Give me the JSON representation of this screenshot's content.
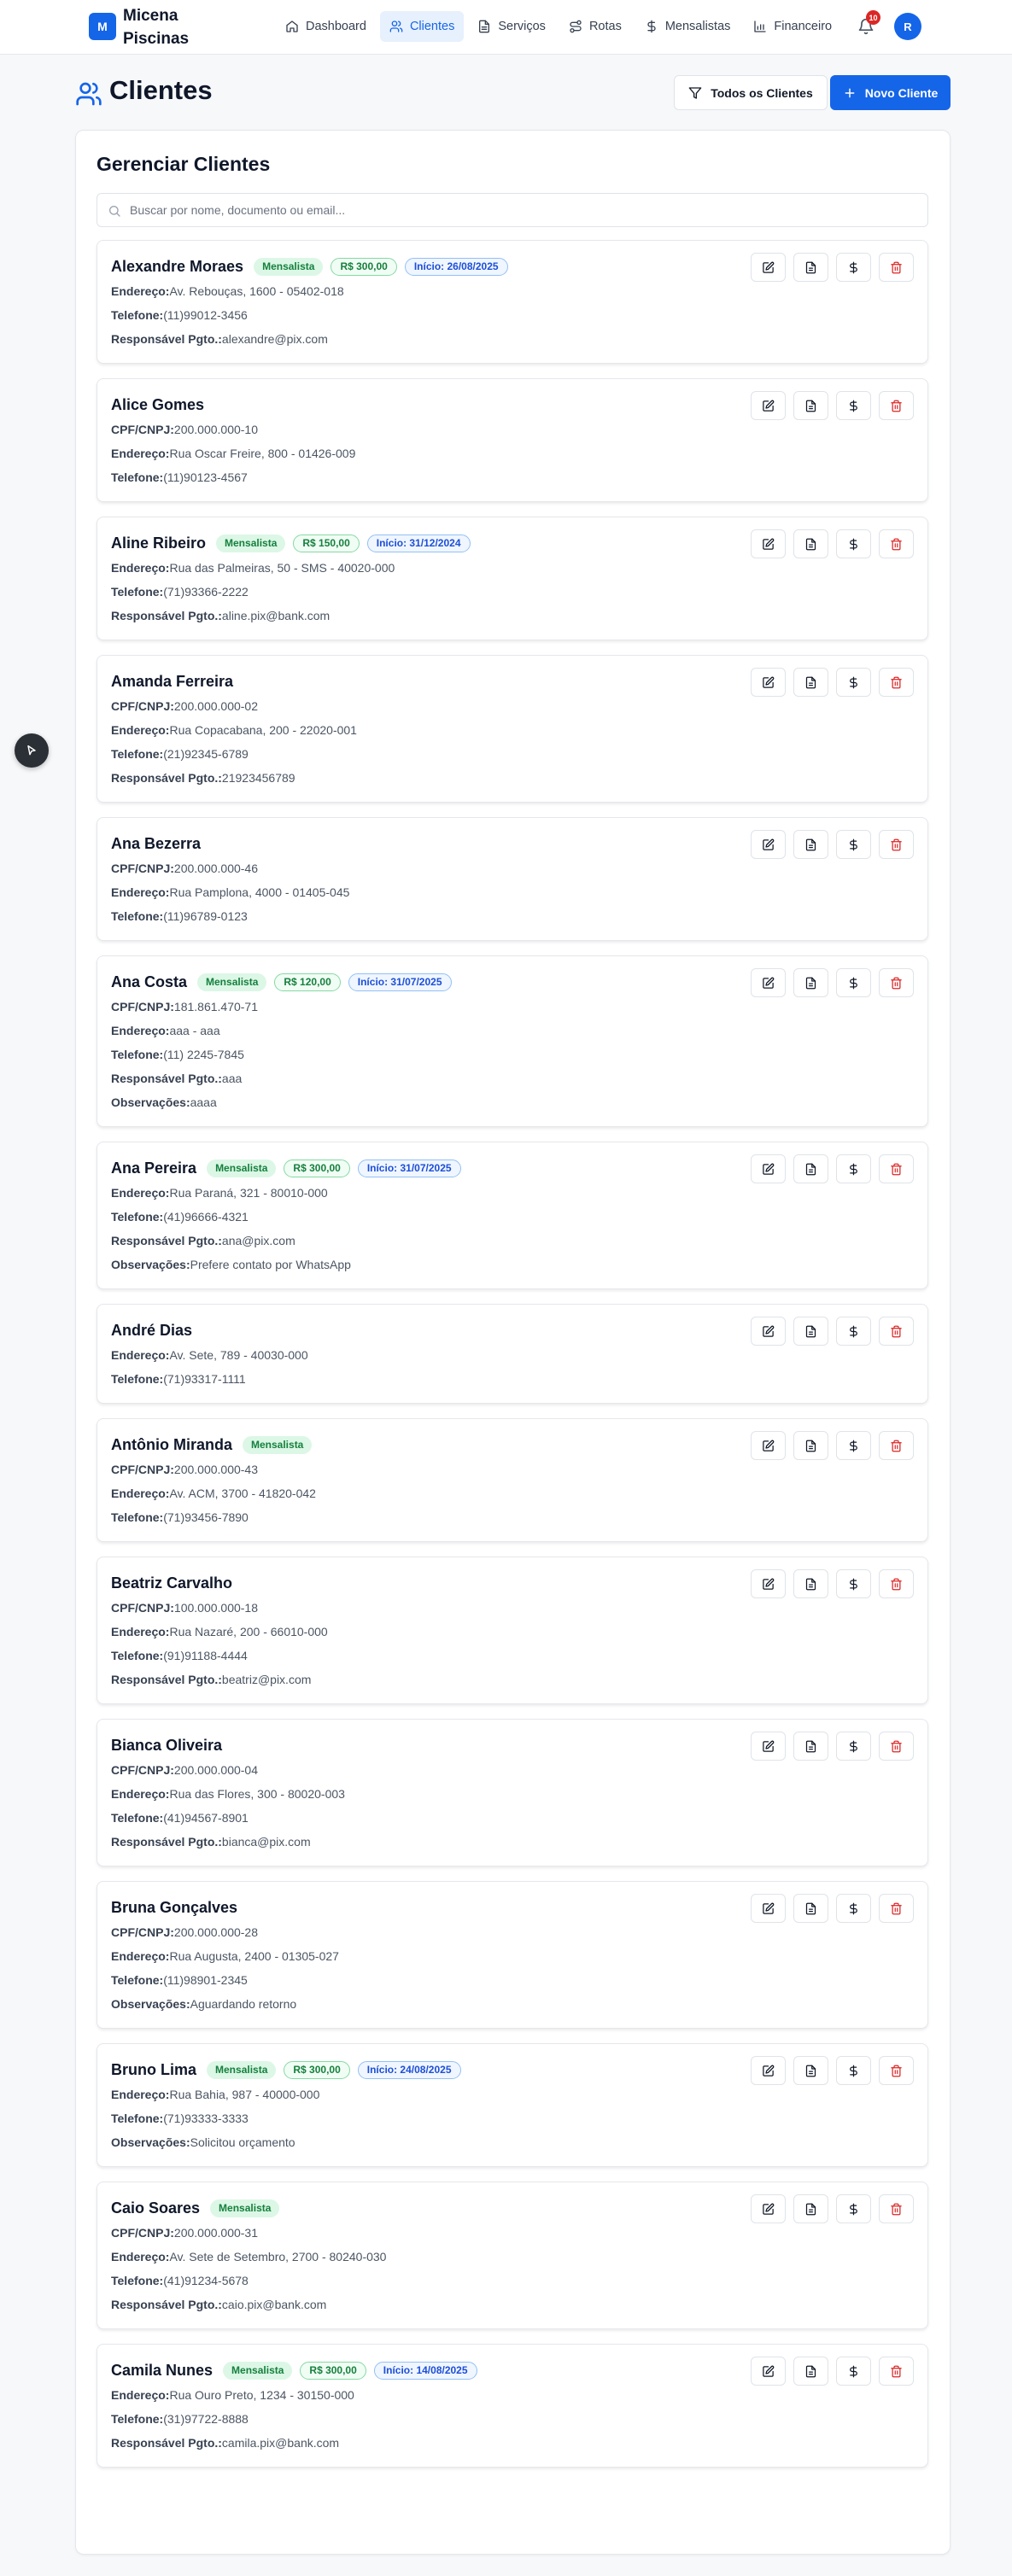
{
  "header": {
    "logo_letter": "M",
    "brand": "Micena Piscinas",
    "nav": [
      {
        "label": "Dashboard",
        "icon": "home-icon"
      },
      {
        "label": "Clientes",
        "icon": "users-icon"
      },
      {
        "label": "Serviços",
        "icon": "file-icon"
      },
      {
        "label": "Rotas",
        "icon": "route-icon"
      },
      {
        "label": "Mensalistas",
        "icon": "dollar-icon"
      },
      {
        "label": "Financeiro",
        "icon": "chart-icon"
      }
    ],
    "active_nav": "Clientes",
    "notifications_count": "10",
    "avatar_letter": "R"
  },
  "page": {
    "title": "Clientes",
    "filter_button": "Todos os Clientes",
    "new_button": "Novo Cliente"
  },
  "panel": {
    "title": "Gerenciar Clientes",
    "search_placeholder": "Buscar por nome, documento ou email...",
    "search_value": ""
  },
  "labels": {
    "cpf": "CPF/CNPJ:",
    "endereco": "Endereço:",
    "telefone": "Telefone:",
    "responsavel": "Responsável Pgto.:",
    "observacoes": "Observações:",
    "mensalista": "Mensalista"
  },
  "colors": {
    "primary": "#1565e8",
    "delete": "#dc2626",
    "badge_green": "#15803d",
    "badge_blue": "#1d4ed8"
  },
  "clients": [
    {
      "name": "Alexandre Moraes",
      "mensalista": true,
      "valor": "R$ 300,00",
      "inicio": "Início: 26/08/2025",
      "fields": [
        [
          "endereco",
          "Av. Rebouças, 1600 - 05402-018"
        ],
        [
          "telefone",
          "(11)99012-3456"
        ],
        [
          "responsavel",
          "alexandre@pix.com"
        ]
      ]
    },
    {
      "name": "Alice Gomes",
      "mensalista": false,
      "fields": [
        [
          "cpf",
          "200.000.000-10"
        ],
        [
          "endereco",
          "Rua Oscar Freire, 800 - 01426-009"
        ],
        [
          "telefone",
          "(11)90123-4567"
        ]
      ]
    },
    {
      "name": "Aline Ribeiro",
      "mensalista": true,
      "valor": "R$ 150,00",
      "inicio": "Início: 31/12/2024",
      "fields": [
        [
          "endereco",
          "Rua das Palmeiras, 50 - SMS - 40020-000"
        ],
        [
          "telefone",
          "(71)93366-2222"
        ],
        [
          "responsavel",
          "aline.pix@bank.com"
        ]
      ]
    },
    {
      "name": "Amanda Ferreira",
      "mensalista": false,
      "fields": [
        [
          "cpf",
          "200.000.000-02"
        ],
        [
          "endereco",
          "Rua Copacabana, 200 - 22020-001"
        ],
        [
          "telefone",
          "(21)92345-6789"
        ],
        [
          "responsavel",
          "21923456789"
        ]
      ]
    },
    {
      "name": "Ana Bezerra",
      "mensalista": false,
      "fields": [
        [
          "cpf",
          "200.000.000-46"
        ],
        [
          "endereco",
          "Rua Pamplona, 4000 - 01405-045"
        ],
        [
          "telefone",
          "(11)96789-0123"
        ]
      ]
    },
    {
      "name": "Ana Costa",
      "mensalista": true,
      "valor": "R$ 120,00",
      "inicio": "Início: 31/07/2025",
      "fields": [
        [
          "cpf",
          "181.861.470-71"
        ],
        [
          "endereco",
          "aaa - aaa"
        ],
        [
          "telefone",
          "(11) 2245-7845"
        ],
        [
          "responsavel",
          "aaa"
        ],
        [
          "observacoes",
          "aaaa"
        ]
      ]
    },
    {
      "name": "Ana Pereira",
      "mensalista": true,
      "valor": "R$ 300,00",
      "inicio": "Início: 31/07/2025",
      "fields": [
        [
          "endereco",
          "Rua Paraná, 321 - 80010-000"
        ],
        [
          "telefone",
          "(41)96666-4321"
        ],
        [
          "responsavel",
          "ana@pix.com"
        ],
        [
          "observacoes",
          "Prefere contato por WhatsApp"
        ]
      ]
    },
    {
      "name": "André Dias",
      "mensalista": false,
      "fields": [
        [
          "endereco",
          "Av. Sete, 789 - 40030-000"
        ],
        [
          "telefone",
          "(71)93317-1111"
        ]
      ]
    },
    {
      "name": "Antônio Miranda",
      "mensalista": true,
      "fields": [
        [
          "cpf",
          "200.000.000-43"
        ],
        [
          "endereco",
          "Av. ACM, 3700 - 41820-042"
        ],
        [
          "telefone",
          "(71)93456-7890"
        ]
      ]
    },
    {
      "name": "Beatriz Carvalho",
      "mensalista": false,
      "fields": [
        [
          "cpf",
          "100.000.000-18"
        ],
        [
          "endereco",
          "Rua Nazaré, 200 - 66010-000"
        ],
        [
          "telefone",
          "(91)91188-4444"
        ],
        [
          "responsavel",
          "beatriz@pix.com"
        ]
      ]
    },
    {
      "name": "Bianca Oliveira",
      "mensalista": false,
      "fields": [
        [
          "cpf",
          "200.000.000-04"
        ],
        [
          "endereco",
          "Rua das Flores, 300 - 80020-003"
        ],
        [
          "telefone",
          "(41)94567-8901"
        ],
        [
          "responsavel",
          "bianca@pix.com"
        ]
      ]
    },
    {
      "name": "Bruna Gonçalves",
      "mensalista": false,
      "fields": [
        [
          "cpf",
          "200.000.000-28"
        ],
        [
          "endereco",
          "Rua Augusta, 2400 - 01305-027"
        ],
        [
          "telefone",
          "(11)98901-2345"
        ],
        [
          "observacoes",
          "Aguardando retorno"
        ]
      ]
    },
    {
      "name": "Bruno Lima",
      "mensalista": true,
      "valor": "R$ 300,00",
      "inicio": "Início: 24/08/2025",
      "fields": [
        [
          "endereco",
          "Rua Bahia, 987 - 40000-000"
        ],
        [
          "telefone",
          "(71)93333-3333"
        ],
        [
          "observacoes",
          "Solicitou orçamento"
        ]
      ]
    },
    {
      "name": "Caio Soares",
      "mensalista": true,
      "fields": [
        [
          "cpf",
          "200.000.000-31"
        ],
        [
          "endereco",
          "Av. Sete de Setembro, 2700 - 80240-030"
        ],
        [
          "telefone",
          "(41)91234-5678"
        ],
        [
          "responsavel",
          "caio.pix@bank.com"
        ]
      ]
    },
    {
      "name": "Camila Nunes",
      "mensalista": true,
      "valor": "R$ 300,00",
      "inicio": "Início: 14/08/2025",
      "fields": [
        [
          "endereco",
          "Rua Ouro Preto, 1234 - 30150-000"
        ],
        [
          "telefone",
          "(31)97722-8888"
        ],
        [
          "responsavel",
          "camila.pix@bank.com"
        ]
      ]
    }
  ]
}
